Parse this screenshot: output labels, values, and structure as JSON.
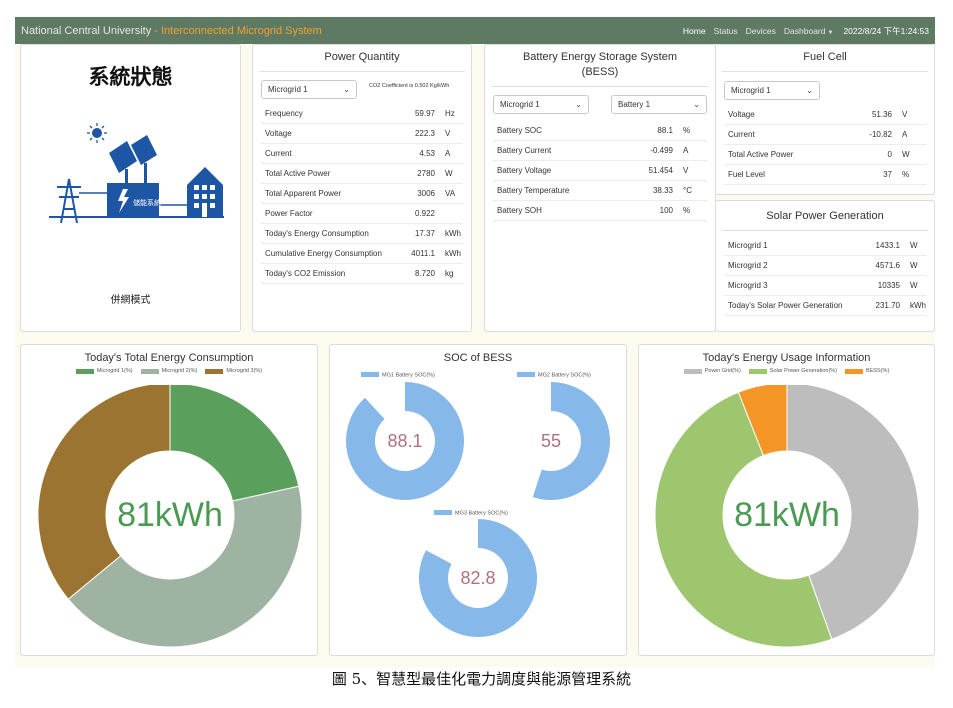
{
  "navbar": {
    "brand_main": "National Central University",
    "brand_sep": " - ",
    "brand_sub": "Interconnected Microgrid System",
    "home": "Home",
    "status": "Status",
    "devices": "Devices",
    "dashboard": "Dashboard",
    "datetime": "2022/8/24 下午1:24:53"
  },
  "system_status": {
    "title": "系統狀態",
    "facility_label": "儲能系統",
    "mode": "併網模式"
  },
  "power_quantity": {
    "title": "Power Quantity",
    "microgrid_select": "Microgrid 1",
    "co2_note": "CO2 Coefficient is 0.502 Kg/kWh",
    "rows": [
      {
        "label": "Frequency",
        "value": "59.97",
        "unit": "Hz"
      },
      {
        "label": "Voltage",
        "value": "222.3",
        "unit": "V"
      },
      {
        "label": "Current",
        "value": "4.53",
        "unit": "A"
      },
      {
        "label": "Total Active Power",
        "value": "2780",
        "unit": "W"
      },
      {
        "label": "Total Apparent Power",
        "value": "3006",
        "unit": "VA"
      },
      {
        "label": "Power Factor",
        "value": "0.922",
        "unit": ""
      },
      {
        "label": "Today's Energy Consumption",
        "value": "17.37",
        "unit": "kWh"
      },
      {
        "label": "Cumulative Energy Consumption",
        "value": "4011.1",
        "unit": "kWh"
      },
      {
        "label": "Today's CO2 Emission",
        "value": "8.720",
        "unit": "kg"
      }
    ]
  },
  "bess": {
    "title_line1": "Battery Energy Storage System",
    "title_line2": "(BESS)",
    "microgrid_select": "Microgrid 1",
    "battery_select": "Battery 1",
    "rows": [
      {
        "label": "Battery SOC",
        "value": "88.1",
        "unit": "%"
      },
      {
        "label": "Battery Current",
        "value": "-0.499",
        "unit": "A"
      },
      {
        "label": "Battery Voltage",
        "value": "51.454",
        "unit": "V"
      },
      {
        "label": "Battery Temperature",
        "value": "38.33",
        "unit": "°C"
      },
      {
        "label": "Battery SOH",
        "value": "100",
        "unit": "%"
      }
    ]
  },
  "fuel_cell": {
    "title": "Fuel Cell",
    "microgrid_select": "Microgrid 1",
    "rows": [
      {
        "label": "Voltage",
        "value": "51.36",
        "unit": "V"
      },
      {
        "label": "Current",
        "value": "-10.82",
        "unit": "A"
      },
      {
        "label": "Total Active Power",
        "value": "0",
        "unit": "W"
      },
      {
        "label": "Fuel Level",
        "value": "37",
        "unit": "%"
      }
    ]
  },
  "solar": {
    "title": "Solar Power Generation",
    "rows": [
      {
        "label": "Microgrid 1",
        "value": "1433.1",
        "unit": "W"
      },
      {
        "label": "Microgrid 2",
        "value": "4571.6",
        "unit": "W"
      },
      {
        "label": "Microgrid 3",
        "value": "10335",
        "unit": "W"
      },
      {
        "label": "Today's Solar Power Generation",
        "value": "231.70",
        "unit": "kWh"
      }
    ]
  },
  "colors": {
    "navbar": "#5f7a63",
    "mg1": "#5aa05c",
    "mg2": "#9fb3a2",
    "mg3": "#9c7432",
    "soc": "#87b8ea",
    "grid": "#bdbdbd",
    "solar": "#9ec66e",
    "bess": "#f39626",
    "center_green": "#4a9a52",
    "center_soc": "#b07080"
  },
  "chart_data": [
    {
      "type": "pie",
      "title": "Today's Total Energy Consumption",
      "center_label": "81kWh",
      "legend": [
        "Microgrid 1(%)",
        "Microgrid 2(%)",
        "Microgrid 3(%)"
      ],
      "values": [
        21.5,
        42.5,
        36.0
      ]
    },
    {
      "type": "pie",
      "title": "SOC of BESS",
      "series": [
        {
          "name": "MG1 Battery SOC(%)",
          "value": 88.1,
          "label": "88.1"
        },
        {
          "name": "MG2 Battery SOC(%)",
          "value": 55,
          "label": "55"
        },
        {
          "name": "MG3 Battery SOC(%)",
          "value": 82.8,
          "label": "82.8"
        }
      ]
    },
    {
      "type": "pie",
      "title": "Today's Energy Usage Information",
      "center_label": "81kWh",
      "legend": [
        "Power Grid(%)",
        "Solar Power Generation(%)",
        "BESS(%)"
      ],
      "values": [
        44.5,
        49.5,
        6.0
      ]
    }
  ],
  "caption": "圖 5、智慧型最佳化電力調度與能源管理系統"
}
